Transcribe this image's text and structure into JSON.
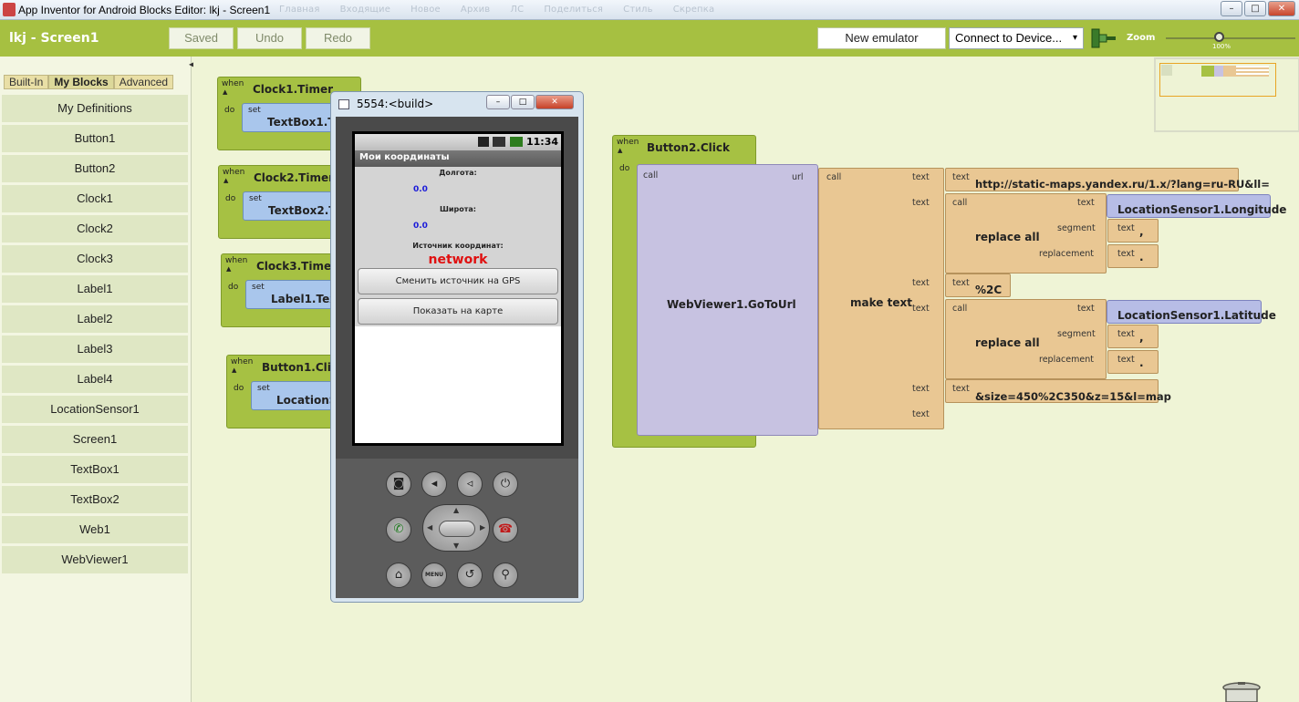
{
  "window": {
    "title": "App Inventor for Android Blocks Editor: lkj - Screen1",
    "ghost_menu": [
      "Главная",
      "Входящие",
      "Новое",
      "Архив",
      "ЛС",
      "Поделиться",
      "Стиль",
      "Скрепка"
    ],
    "controls": {
      "minimize": "–",
      "maximize": "□",
      "close": "✕"
    }
  },
  "toolbar": {
    "project": "lkj - Screen1",
    "saved": "Saved",
    "undo": "Undo",
    "redo": "Redo",
    "new_emulator": "New emulator",
    "connect": "Connect to Device...",
    "zoom_label": "Zoom",
    "zoom_value": "100%"
  },
  "palette": {
    "tabs": [
      "Built-In",
      "My Blocks",
      "Advanced"
    ],
    "selected_tab": "My Blocks",
    "drawers": [
      "My Definitions",
      "Button1",
      "Button2",
      "Clock1",
      "Clock2",
      "Clock3",
      "Label1",
      "Label2",
      "Label3",
      "Label4",
      "LocationSensor1",
      "Screen1",
      "TextBox1",
      "TextBox2",
      "Web1",
      "WebViewer1"
    ]
  },
  "blocks": {
    "when": "when",
    "do": "do",
    "set": "set",
    "call": "call",
    "text": "text",
    "url": "url",
    "segment": "segment",
    "replacement": "replacement",
    "events": [
      {
        "name": "Clock1.Timer",
        "setter": "TextBox1.Te"
      },
      {
        "name": "Clock2.Timer",
        "setter": "TextBox2.Te"
      },
      {
        "name": "Clock3.Timer",
        "setter": "Label1.Text"
      },
      {
        "name": "Button1.Click",
        "setter": "LocationSe"
      }
    ],
    "button2": {
      "event": "Button2.Click",
      "call": "WebViewer1.GoToUrl",
      "make_text": "make text",
      "replace_all": "replace all",
      "url_text": "http://static-maps.yandex.ru/1.x/?lang=ru-RU&ll=",
      "longitude": "LocationSensor1.Longitude",
      "latitude": "LocationSensor1.Latitude",
      "comma": ",",
      "dot": ".",
      "sep": "%2C",
      "suffix": "&size=450%2C350&z=15&l=map"
    }
  },
  "emulator": {
    "title": "5554:<build>",
    "time": "11:34",
    "app_title": "Мои координаты",
    "lon_label": "Долгота:",
    "lon_value": "0.0",
    "lat_label": "Широта:",
    "lat_value": "0.0",
    "source_label": "Источник координат:",
    "source_value": "network",
    "btn_gps": "Сменить источник на GPS",
    "btn_map": "Показать на карте",
    "menu_key": "MENU"
  }
}
